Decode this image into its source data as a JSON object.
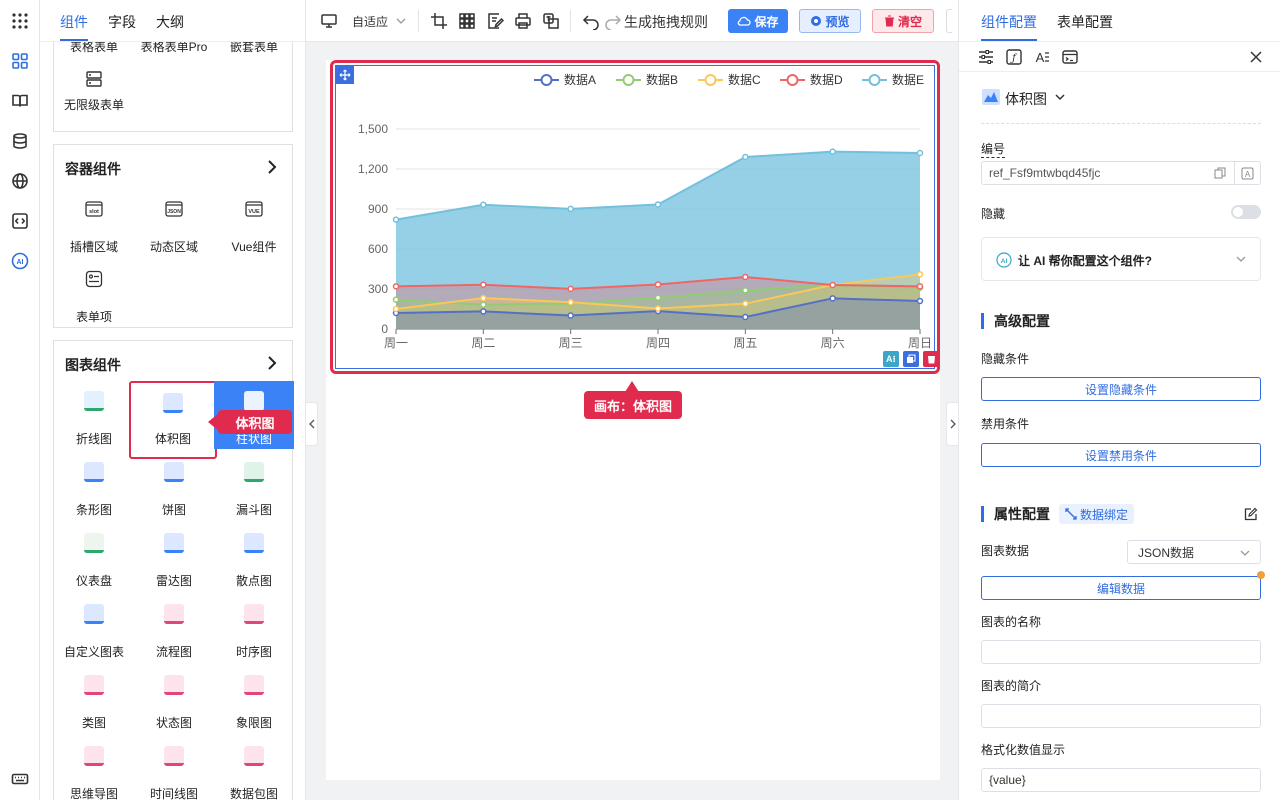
{
  "left_tabs": [
    "组件",
    "字段",
    "大纲"
  ],
  "sections": {
    "form_top": {
      "items": [
        "表格表单",
        "表格表单Pro",
        "嵌套表单",
        "无限级表单"
      ]
    },
    "container": {
      "title": "容器组件",
      "items": [
        "插槽区域",
        "动态区域",
        "Vue组件",
        "表单项"
      ]
    },
    "chart": {
      "title": "图表组件",
      "items": [
        "折线图",
        "体积图",
        "柱状图",
        "条形图",
        "饼图",
        "漏斗图",
        "仪表盘",
        "雷达图",
        "散点图",
        "自定义图表",
        "流程图",
        "时序图",
        "类图",
        "状态图",
        "象限图",
        "思维导图",
        "时间线图",
        "数据包图"
      ]
    }
  },
  "icons": {
    "slot": "slot",
    "json": "JSON",
    "vue": "VUE"
  },
  "toolbar": {
    "adapt": "自适应",
    "gen_rules": "生成拖拽规则",
    "save": "保存",
    "preview": "预览",
    "clear": "清空"
  },
  "tags": {
    "item": "体积图",
    "canvas": "画布：体积图"
  },
  "chart_data": {
    "type": "area",
    "categories": [
      "周一",
      "周二",
      "周三",
      "周四",
      "周五",
      "周六",
      "周日"
    ],
    "yticks": [
      "0",
      "300",
      "600",
      "900",
      "1,200",
      "1,500"
    ],
    "ylim": [
      0,
      1500
    ],
    "legend_position": "top-right",
    "grid": true,
    "series": [
      {
        "name": "数据A",
        "color": "#5470c6",
        "values": [
          120,
          132,
          101,
          134,
          90,
          230,
          210
        ]
      },
      {
        "name": "数据B",
        "color": "#91cc75",
        "values": [
          220,
          182,
          191,
          234,
          290,
          330,
          310
        ]
      },
      {
        "name": "数据C",
        "color": "#fac858",
        "values": [
          150,
          232,
          201,
          154,
          190,
          330,
          410
        ]
      },
      {
        "name": "数据D",
        "color": "#ee6666",
        "values": [
          320,
          332,
          301,
          334,
          390,
          330,
          320
        ]
      },
      {
        "name": "数据E",
        "color": "#73c0de",
        "values": [
          820,
          932,
          901,
          934,
          1290,
          1330,
          1320
        ]
      }
    ]
  },
  "right": {
    "tabs": [
      "组件配置",
      "表单配置"
    ],
    "component_type": "体积图",
    "id_label": "编号",
    "id_value": "ref_Fsf9mtwbqd45fjc",
    "hidden_label": "隐藏",
    "ai_text": "让 AI 帮你配置这个组件?",
    "advanced_title": "高级配置",
    "hide_cond_label": "隐藏条件",
    "hide_cond_btn": "设置隐藏条件",
    "disable_cond_label": "禁用条件",
    "disable_cond_btn": "设置禁用条件",
    "props_title": "属性配置",
    "data_binding": "数据绑定",
    "chart_data_label": "图表数据",
    "chart_data_select": "JSON数据",
    "edit_data_btn": "编辑数据",
    "chart_name_label": "图表的名称",
    "chart_desc_label": "图表的简介",
    "format_label": "格式化数值显示",
    "format_value": "{value}"
  },
  "colors": {
    "accent": "#2f6de0",
    "danger": "#e02b4e"
  }
}
